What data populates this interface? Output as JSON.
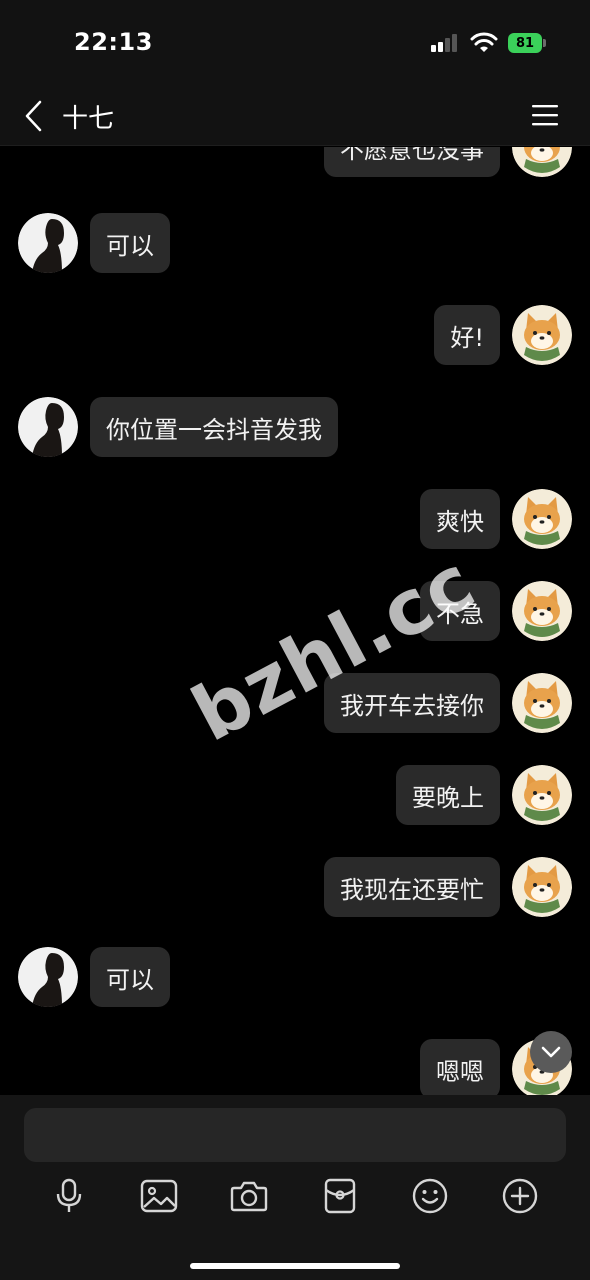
{
  "status": {
    "time": "22:13",
    "battery": "81"
  },
  "header": {
    "title": "十七"
  },
  "messages": [
    {
      "side": "right",
      "text": "不愿意也没事"
    },
    {
      "side": "left",
      "text": "可以"
    },
    {
      "side": "right",
      "text": "好!"
    },
    {
      "side": "left",
      "text": "你位置一会抖音发我"
    },
    {
      "side": "right",
      "text": "爽快"
    },
    {
      "side": "right",
      "text": "不急"
    },
    {
      "side": "right",
      "text": "我开车去接你"
    },
    {
      "side": "right",
      "text": "要晚上"
    },
    {
      "side": "right",
      "text": "我现在还要忙"
    },
    {
      "side": "left",
      "text": "可以"
    },
    {
      "side": "right",
      "text": "嗯嗯"
    }
  ],
  "watermark": "bzhl.cc",
  "toolbar": {
    "icons": [
      "microphone-icon",
      "image-icon",
      "camera-icon",
      "red-packet-icon",
      "emoji-icon",
      "plus-icon"
    ]
  },
  "colors": {
    "bubble": "#2a2a2a",
    "battery": "#3bd15a",
    "background": "#000000"
  }
}
